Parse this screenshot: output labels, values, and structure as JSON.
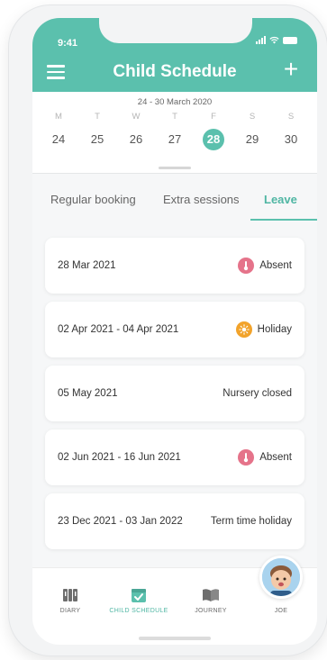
{
  "status_bar": {
    "time": "9:41"
  },
  "header": {
    "title": "Child Schedule",
    "add_label": "+"
  },
  "week": {
    "range": "24 - 30 March 2020",
    "days": [
      {
        "letter": "M",
        "date": "24"
      },
      {
        "letter": "T",
        "date": "25"
      },
      {
        "letter": "W",
        "date": "26"
      },
      {
        "letter": "T",
        "date": "27"
      },
      {
        "letter": "F",
        "date": "28"
      },
      {
        "letter": "S",
        "date": "29"
      },
      {
        "letter": "S",
        "date": "30"
      }
    ],
    "selected_date": "28"
  },
  "tabs": [
    {
      "label": "Regular booking"
    },
    {
      "label": "Extra sessions"
    },
    {
      "label": "Leave"
    }
  ],
  "active_tab": "Leave",
  "leave_items": [
    {
      "date": "28 Mar 2021",
      "status": "Absent",
      "icon": "thermometer-icon"
    },
    {
      "date": "02 Apr 2021 - 04 Apr 2021",
      "status": "Holiday",
      "icon": "sun-icon"
    },
    {
      "date": "05 May 2021",
      "status": "Nursery closed",
      "icon": ""
    },
    {
      "date": "02 Jun 2021 - 16 Jun 2021",
      "status": "Absent",
      "icon": "thermometer-icon"
    },
    {
      "date": "23 Dec 2021 - 03 Jan 2022",
      "status": "Term time holiday",
      "icon": ""
    }
  ],
  "bottom_nav": [
    {
      "label": "DIARY",
      "icon": "diary-icon"
    },
    {
      "label": "CHILD SCHEDULE",
      "icon": "calendar-check-icon"
    },
    {
      "label": "JOURNEY",
      "icon": "book-icon"
    },
    {
      "label": "JOE",
      "icon": "child-avatar"
    }
  ],
  "colors": {
    "brand": "#5bc0ad",
    "absent": "#e5738a",
    "holiday": "#f2a32b"
  }
}
